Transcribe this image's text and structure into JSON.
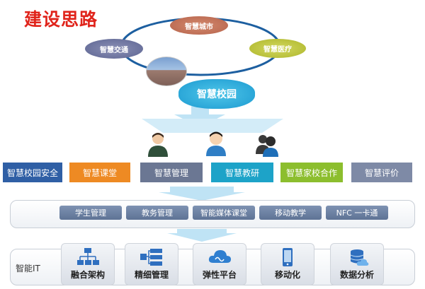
{
  "title": "建设思路",
  "clouds": {
    "city": "智慧城市",
    "traffic": "智慧交通",
    "medical": "智慧医疗",
    "campus": "智慧校园"
  },
  "app_boxes": [
    {
      "label": "智慧校园安全",
      "color": "#2f5fa5"
    },
    {
      "label": "智慧课堂",
      "color": "#ee8a23"
    },
    {
      "label": "智慧管理",
      "color": "#6b7793"
    },
    {
      "label": "智慧教研",
      "color": "#1da3c8"
    },
    {
      "label": "智慧家校合作",
      "color": "#8cbe2e"
    },
    {
      "label": "智慧评价",
      "color": "#7e8aa6"
    }
  ],
  "services": [
    "学生管理",
    "教务管理",
    "智能媒体课堂",
    "移动教学",
    "NFC 一卡通"
  ],
  "it_label": "智能IT",
  "it_tiles": [
    {
      "label": "融合架构",
      "icon": "network-icon"
    },
    {
      "label": "精细管理",
      "icon": "flow-chart-icon"
    },
    {
      "label": "弹性平台",
      "icon": "cloud-icon"
    },
    {
      "label": "移动化",
      "icon": "mobile-icon"
    },
    {
      "label": "数据分析",
      "icon": "database-cloud-icon"
    }
  ]
}
